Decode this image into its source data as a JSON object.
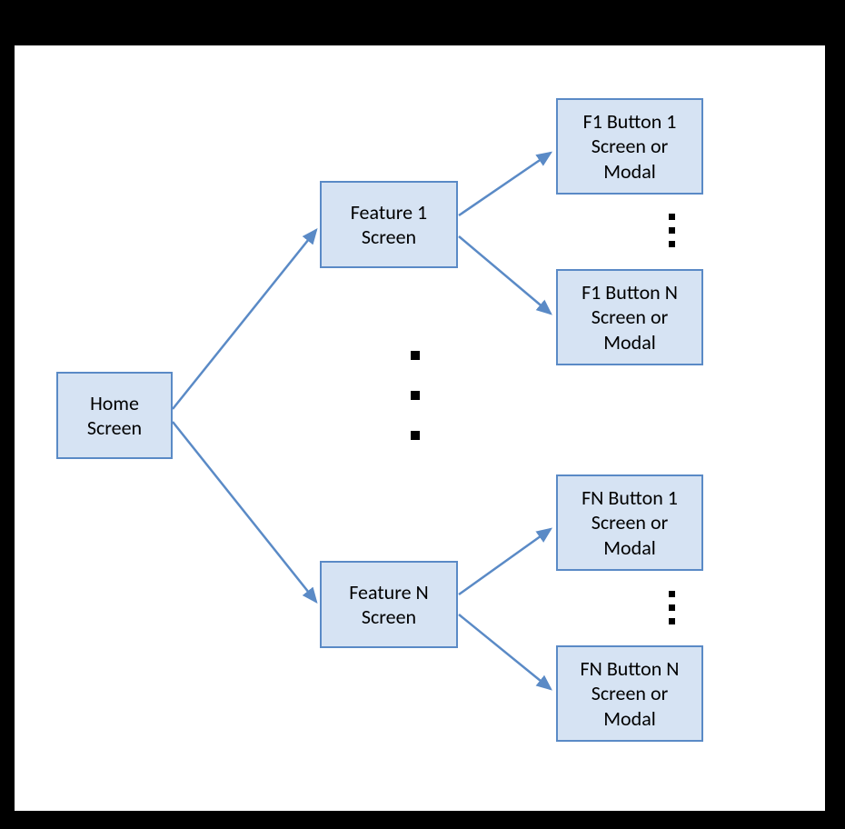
{
  "nodes": {
    "home": "Home Screen",
    "feature1": "Feature 1 Screen",
    "featureN": "Feature N Screen",
    "f1_button1": "F1 Button 1 Screen or Modal",
    "f1_buttonN": "F1 Button N Screen or Modal",
    "fN_button1": "FN Button 1 Screen or Modal",
    "fN_buttonN": "FN Button N Screen or Modal"
  },
  "colors": {
    "node_fill": "#d6e3f3",
    "node_border": "#5a8ac6",
    "arrow": "#5a8ac6",
    "background": "#000000",
    "panel": "#ffffff"
  }
}
